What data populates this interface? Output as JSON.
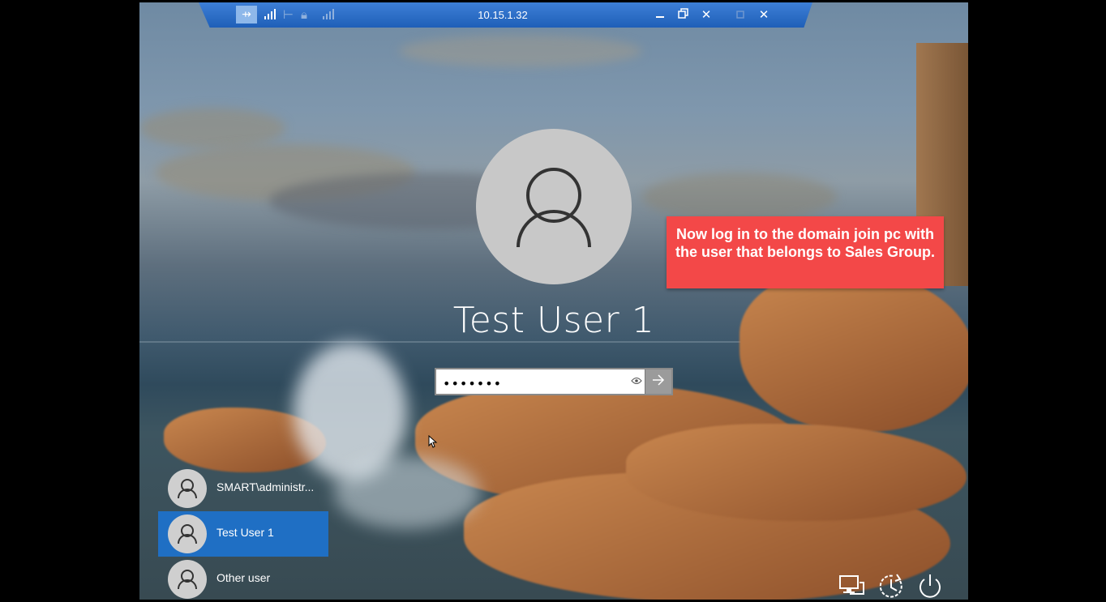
{
  "rdp_bar": {
    "title": "10.15.1.32",
    "pin_icon": "pin-icon",
    "signal_icon": "signal-bars-icon",
    "lock_icon": "lock-icon",
    "minimize_icon": "minimize-icon",
    "restore_icon": "restore-icon",
    "close_icon": "close-icon"
  },
  "login": {
    "user_name": "Test User 1",
    "password_value": "•••••••",
    "reveal_icon": "eye-icon",
    "submit_icon": "arrow-right-icon"
  },
  "callout": {
    "text": "Now log in to the domain join pc with the user that belongs to Sales Group."
  },
  "user_list": [
    {
      "label": "SMART\\administr...",
      "selected": false
    },
    {
      "label": "Test User 1",
      "selected": true
    },
    {
      "label": "Other user",
      "selected": false
    }
  ],
  "system_icons": [
    "network-icon",
    "ease-of-access-icon",
    "power-icon"
  ]
}
